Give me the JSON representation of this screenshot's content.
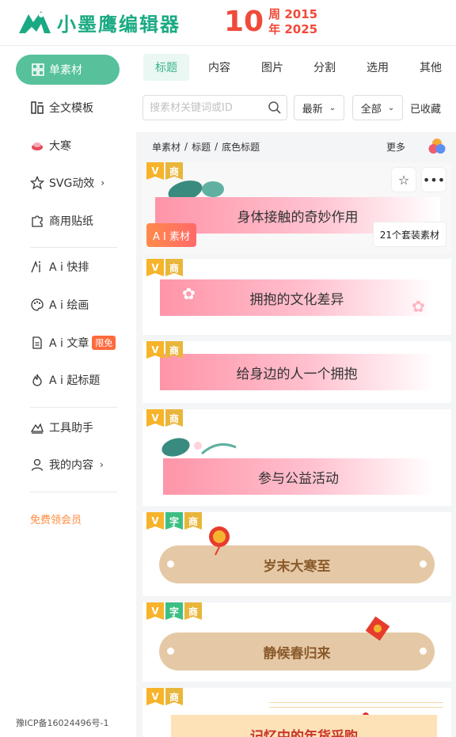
{
  "header": {
    "logo_text": "小墨鹰编辑器",
    "anniversary_number": "10",
    "anniversary_line1": "周 2015",
    "anniversary_line2": "年 2025"
  },
  "sidebar": {
    "active_item": "单素材",
    "items": [
      {
        "label": "全文模板",
        "icon": "template-icon"
      },
      {
        "label": "大寒",
        "icon": "festival-icon"
      },
      {
        "label": "SVG动效",
        "icon": "star-icon",
        "arrow": "›"
      },
      {
        "label": "商用贴纸",
        "icon": "puzzle-icon"
      },
      {
        "label": "A i 快排",
        "icon": "ai-layout-icon"
      },
      {
        "label": "A i 绘画",
        "icon": "palette-icon"
      },
      {
        "label": "A i 文章",
        "icon": "document-icon",
        "badge": "限免"
      },
      {
        "label": "A i 起标题",
        "icon": "flame-icon"
      },
      {
        "label": "工具助手",
        "icon": "tools-icon"
      },
      {
        "label": "我的内容",
        "icon": "user-icon",
        "arrow": "›"
      }
    ],
    "promo": "免费领会员",
    "icp": "豫ICP备16024496号-1"
  },
  "tabs": [
    {
      "label": "标题",
      "active": true
    },
    {
      "label": "内容"
    },
    {
      "label": "图片"
    },
    {
      "label": "分割"
    },
    {
      "label": "选用"
    },
    {
      "label": "其他"
    }
  ],
  "filters": {
    "search_placeholder": "搜素材关键词或ID",
    "sort_value": "最新",
    "category_value": "全部",
    "collected_label": "已收藏"
  },
  "breadcrumb": {
    "parts": [
      "单素材",
      "标题",
      "底色标题"
    ],
    "separator": "/",
    "more_label": "更多"
  },
  "cards": [
    {
      "tags": [
        "V",
        "商"
      ],
      "title": "身体接触的奇妙作用",
      "ai_tag": "A I 素材",
      "set_label": "21个套装素材"
    },
    {
      "tags": [
        "V",
        "商"
      ],
      "title": "拥抱的文化差异"
    },
    {
      "tags": [
        "V",
        "商"
      ],
      "title": "给身边的人一个拥抱"
    },
    {
      "tags": [
        "V",
        "商"
      ],
      "title": "参与公益活动"
    },
    {
      "tags": [
        "V",
        "字",
        "商"
      ],
      "title": "岁末大寒至"
    },
    {
      "tags": [
        "V",
        "字",
        "商"
      ],
      "title": "静候春归来"
    },
    {
      "tags": [
        "V",
        "商"
      ],
      "title": "记忆中的年货采购"
    }
  ],
  "colors": {
    "brand_green": "#1aaa83",
    "active_green": "#56c19b",
    "anniversary_red": "#f04a3a",
    "promo_orange": "#ff8a3d"
  }
}
